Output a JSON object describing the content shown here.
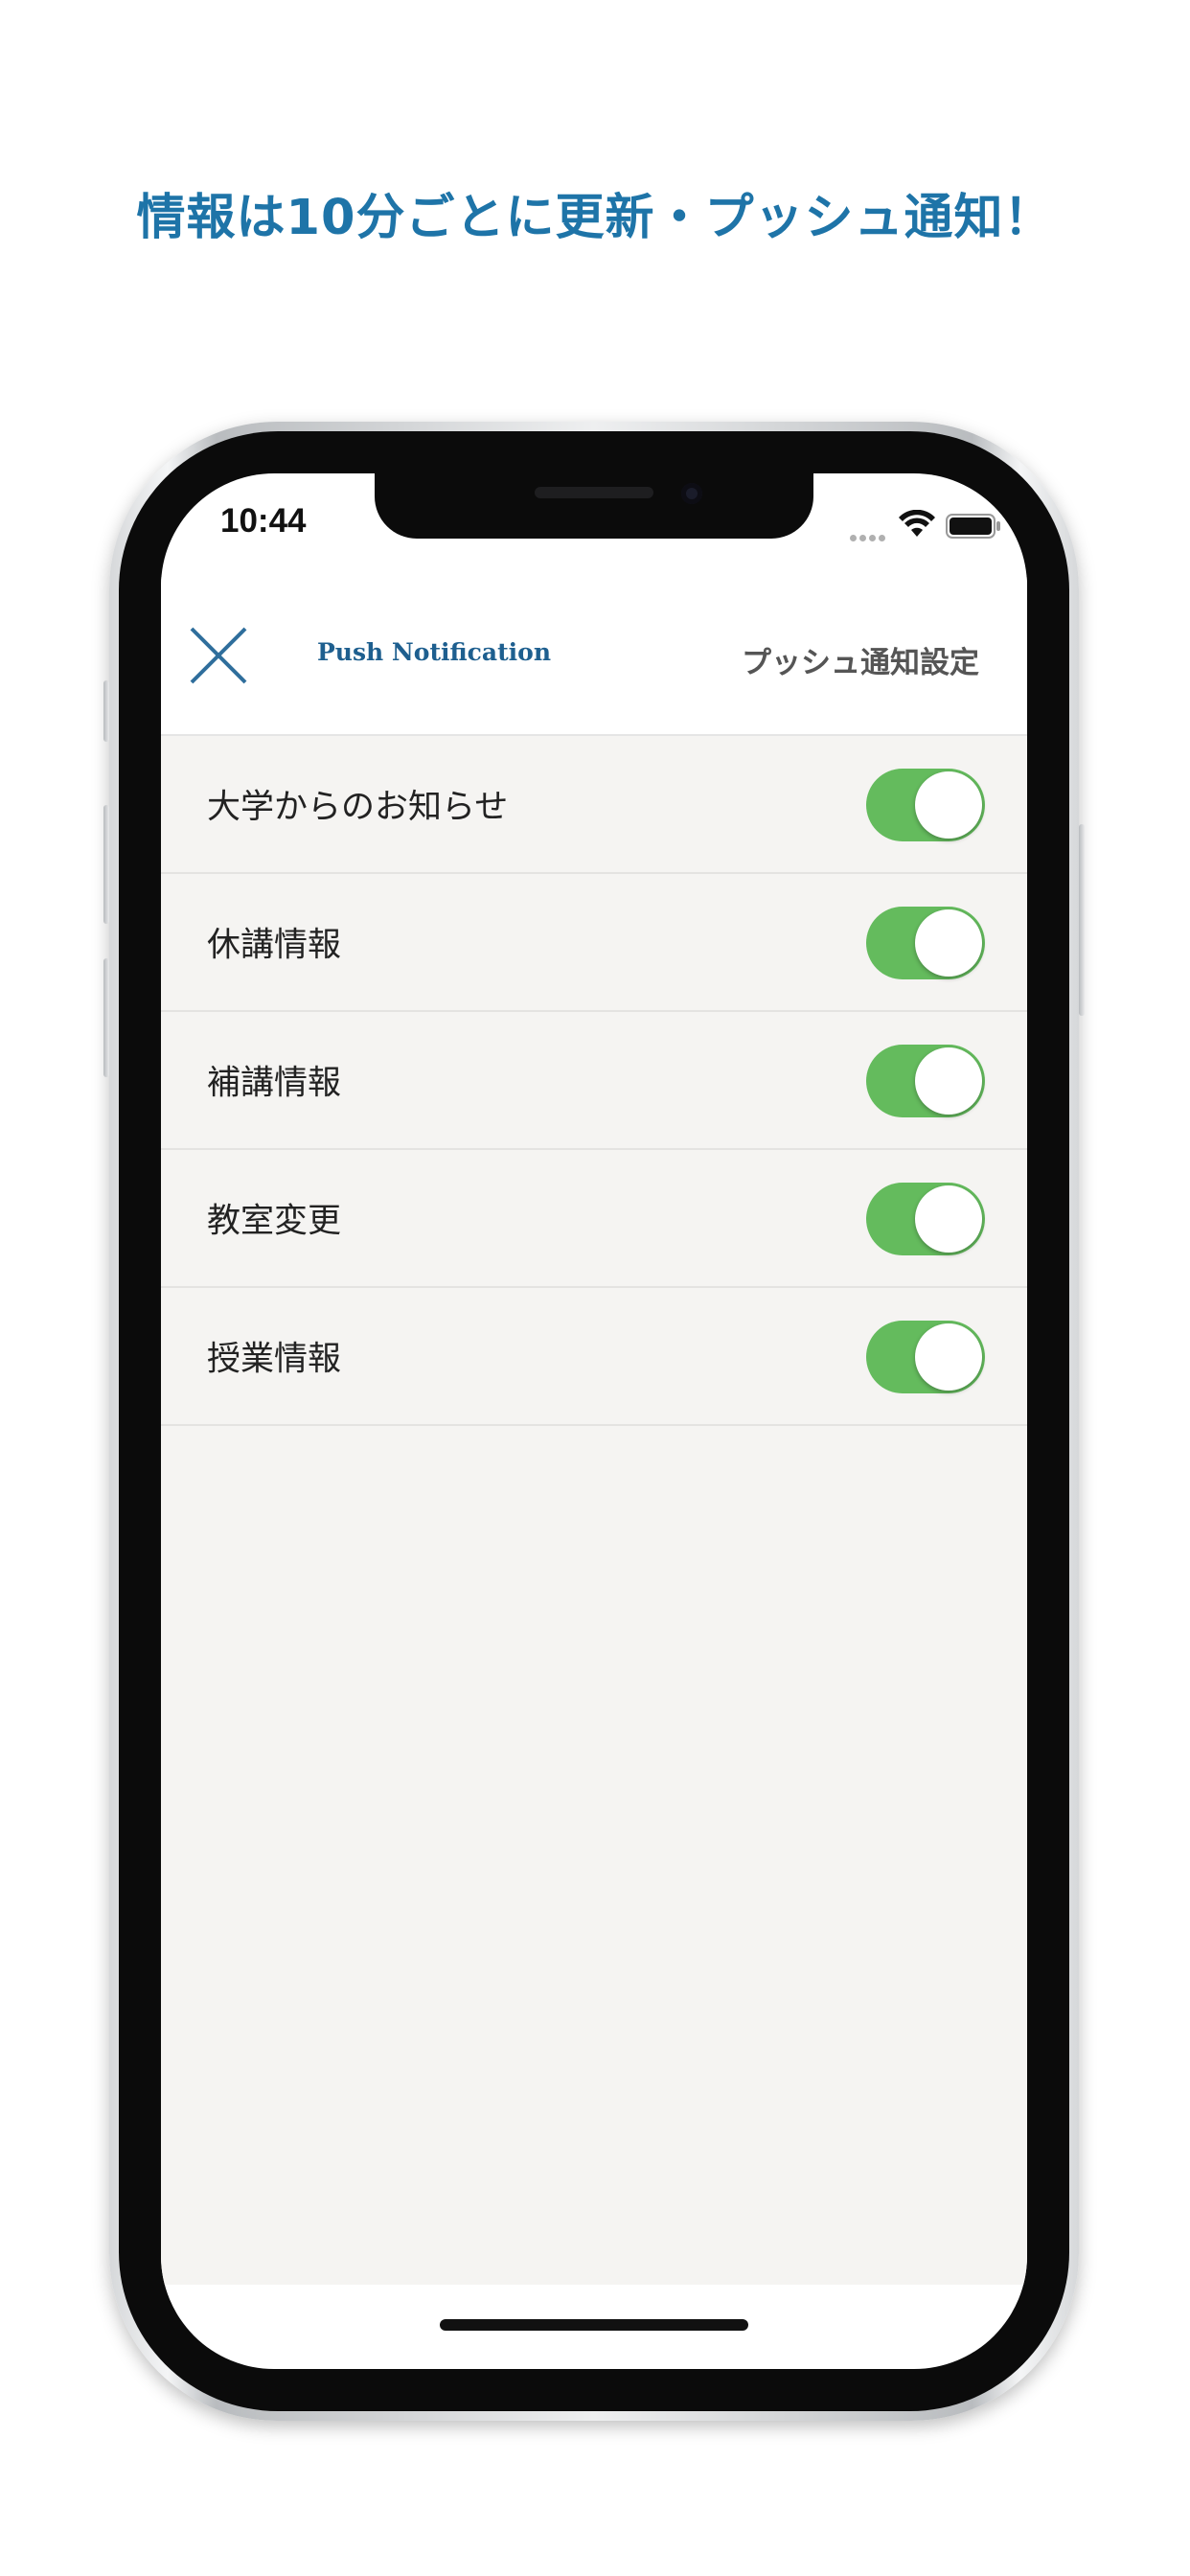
{
  "headline": "情報は10分ごとに更新・プッシュ通知！",
  "status_bar": {
    "time": "10:44",
    "icons": [
      "signal-dots-icon",
      "wifi-icon",
      "battery-icon"
    ]
  },
  "header": {
    "close_icon": "close-icon",
    "brand_title": "Push Notification",
    "page_title": "プッシュ通知設定"
  },
  "settings": {
    "items": [
      {
        "label": "大学からのお知らせ",
        "enabled": true
      },
      {
        "label": "休講情報",
        "enabled": true
      },
      {
        "label": "補講情報",
        "enabled": true
      },
      {
        "label": "教室変更",
        "enabled": true
      },
      {
        "label": "授業情報",
        "enabled": true
      }
    ]
  },
  "colors": {
    "headline": "#1e74a8",
    "brand": "#1e5f8f",
    "toggle_on": "#64bb5d",
    "list_background": "#f5f4f2"
  }
}
